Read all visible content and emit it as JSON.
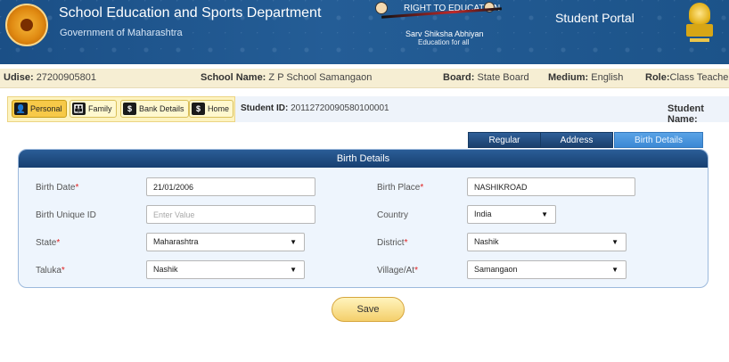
{
  "header": {
    "department": "School Education and Sports Department",
    "government": "Government of Maharashtra",
    "rte_title": "RIGHT TO EDUCATION",
    "rte_sub": "Sarv Shiksha Abhiyan",
    "rte_tagline": "Education for all",
    "portal": "Student Portal",
    "emblem_icon": "maharashtra-emblem-icon",
    "national_icon": "ashoka-emblem-icon"
  },
  "info": {
    "udise_label": "Udise:",
    "udise": "27200905801",
    "school_label": "School Name:",
    "school": "Z P School Samangaon",
    "board_label": "Board:",
    "board": "State Board",
    "medium_label": "Medium:",
    "medium": "English",
    "role_label": "Role:",
    "role": "Class Teacher"
  },
  "tabs": [
    {
      "label": "Personal",
      "icon": "person-icon",
      "glyph": "👤"
    },
    {
      "label": "Family",
      "icon": "family-icon",
      "glyph": "👪"
    },
    {
      "label": "Bank Details",
      "icon": "dollar-icon",
      "glyph": "$"
    },
    {
      "label": "Home",
      "icon": "dollar-icon",
      "glyph": "$"
    }
  ],
  "student": {
    "id_label": "Student ID:",
    "id": "20112720090580100001",
    "name_label": "Student Name:"
  },
  "subtabs": [
    "Regular",
    "Address",
    "Birth Details"
  ],
  "panel": {
    "title": "Birth Details",
    "fields": {
      "birth_date_label": "Birth Date",
      "birth_date": "21/01/2006",
      "birth_place_label": "Birth Place",
      "birth_place": "NASHIKROAD",
      "birth_uid_label": "Birth Unique ID",
      "birth_uid_placeholder": "Enter Value",
      "country_label": "Country",
      "country": "India",
      "state_label": "State",
      "state": "Maharashtra",
      "district_label": "District",
      "district": "Nashik",
      "taluka_label": "Taluka",
      "taluka": "Nashik",
      "village_label": "Village/At",
      "village": "Samangaon"
    },
    "required_marker": "*"
  },
  "save_label": "Save",
  "colors": {
    "header_blue": "#1f5690",
    "accent_yellow": "#f7c948",
    "required": "#e02020"
  }
}
